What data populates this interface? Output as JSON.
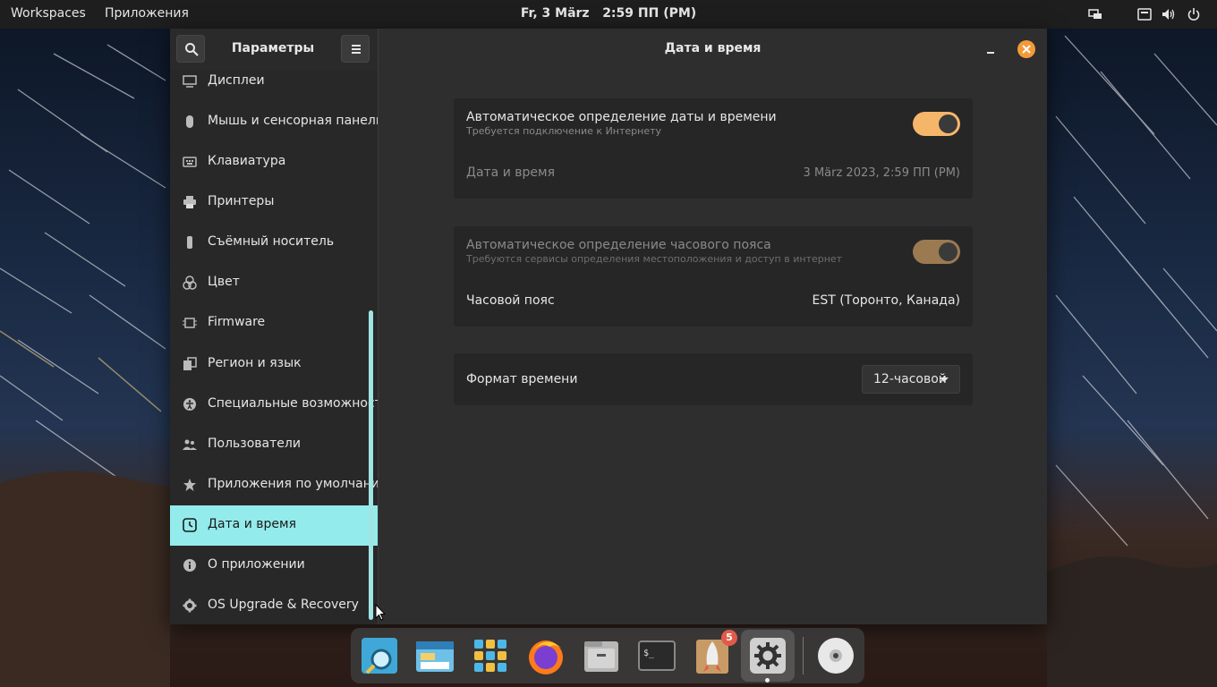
{
  "topbar": {
    "workspaces": "Workspaces",
    "apps": "Приложения",
    "clock": "Fr, 3 März   2:59 ПП (PM)",
    "tray_icons": [
      "display-icon",
      "keyboard-icon",
      "volume-icon",
      "power-icon"
    ]
  },
  "sidebar": {
    "title": "Параметры",
    "items": [
      {
        "label": "Дисплеи",
        "icon": "display-icon"
      },
      {
        "label": "Мышь и сенсорная панель",
        "icon": "mouse-icon"
      },
      {
        "label": "Клавиатура",
        "icon": "keyboard-icon"
      },
      {
        "label": "Принтеры",
        "icon": "printer-icon"
      },
      {
        "label": "Съёмный носитель",
        "icon": "usb-drive-icon"
      },
      {
        "label": "Цвет",
        "icon": "color-icon"
      },
      {
        "label": "Firmware",
        "icon": "chip-icon"
      },
      {
        "label": "Регион и язык",
        "icon": "language-icon"
      },
      {
        "label": "Специальные возможности",
        "icon": "accessibility-icon"
      },
      {
        "label": "Пользователи",
        "icon": "users-icon"
      },
      {
        "label": "Приложения по умолчанию",
        "icon": "star-icon"
      },
      {
        "label": "Дата и время",
        "icon": "clock-icon",
        "active": true
      },
      {
        "label": "О приложении",
        "icon": "info-icon"
      },
      {
        "label": "OS Upgrade & Recovery",
        "icon": "gear-icon"
      }
    ]
  },
  "content": {
    "title": "Дата и время",
    "auto_datetime": {
      "title": "Автоматическое определение даты и времени",
      "subtitle": "Требуется подключение к Интернету",
      "enabled": true
    },
    "datetime": {
      "label": "Дата и время",
      "value": "3 März 2023,  2:59 ПП (PM)"
    },
    "auto_timezone": {
      "title": "Автоматическое определение часового пояса",
      "subtitle": "Требуются сервисы определения местоположения и доступ в интернет",
      "enabled": true,
      "disabled_state": true
    },
    "timezone": {
      "label": "Часовой пояс",
      "value": "EST (Торонто, Канада)"
    },
    "time_format": {
      "label": "Формат времени",
      "selected": "12-часовой"
    }
  },
  "dock": {
    "items": [
      "search-app-icon",
      "files-manager-icon",
      "app-grid-icon",
      "firefox-icon",
      "file-cabinet-icon",
      "terminal-icon",
      "rocket-launcher-icon",
      "settings-icon",
      "disc-icon"
    ],
    "badge_count": "5"
  },
  "colors": {
    "accent": "#94ebeb",
    "toggle_on": "#f6b66a",
    "close": "#f39a38"
  }
}
